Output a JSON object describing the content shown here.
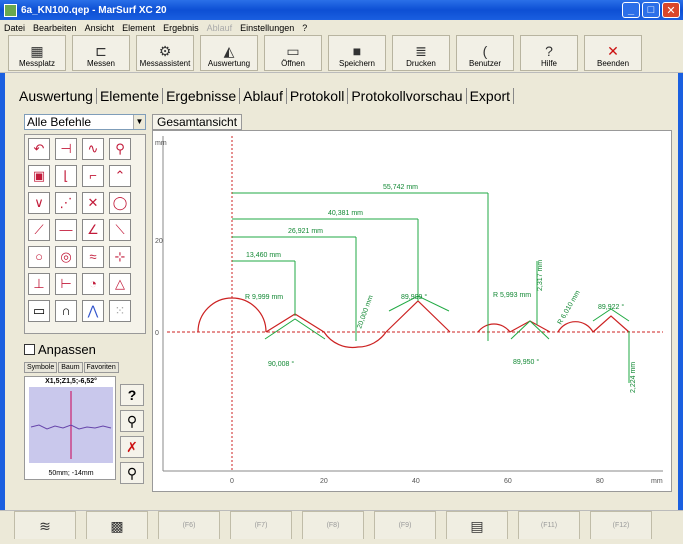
{
  "window": {
    "title": "6a_KN100.qep - MarSurf XC 20"
  },
  "menu": [
    "Datei",
    "Bearbeiten",
    "Ansicht",
    "Element",
    "Ergebnis",
    "Ablauf",
    "Einstellungen",
    "?"
  ],
  "toolbar": [
    {
      "label": "Messplatz",
      "icon": "workstation-icon"
    },
    {
      "label": "Messen",
      "icon": "measure-icon"
    },
    {
      "label": "Messassistent",
      "icon": "assistant-icon"
    },
    {
      "label": "Auswertung",
      "icon": "evaluation-icon"
    },
    {
      "label": "Öffnen",
      "icon": "open-folder-icon"
    },
    {
      "label": "Speichern",
      "icon": "save-icon"
    },
    {
      "label": "Drucken",
      "icon": "print-icon"
    },
    {
      "label": "Benutzer",
      "icon": "user-icon"
    },
    {
      "label": "Hilfe",
      "icon": "help-icon"
    },
    {
      "label": "Beenden",
      "icon": "exit-icon"
    }
  ],
  "tabs": [
    "Auswertung",
    "Elemente",
    "Ergebnisse",
    "Ablauf",
    "Protokoll",
    "Protokollvorschau",
    "Export"
  ],
  "left": {
    "dropdown": "Alle Befehle",
    "checkbox_label": "Anpassen",
    "subtabs": [
      "Symbole",
      "Baum",
      "Favoriten"
    ],
    "preview_title": "X1,5;Z1,5;-6,52°",
    "preview_footer": "50mm; -14mm"
  },
  "view": {
    "tab": "Gesamtansicht",
    "x_unit": "mm",
    "y_unit": "mm"
  },
  "chart_data": {
    "type": "line",
    "xlabel": "mm",
    "ylabel": "mm",
    "x_ticks": [
      "0",
      "20",
      "40",
      "60",
      "80"
    ],
    "y_ticks": [
      "0",
      "20"
    ],
    "annotations": [
      "55,742 mm",
      "40,381 mm",
      "26,921 mm",
      "13,460 mm",
      "R 9,999 mm",
      "20,000 mm",
      "89,999 °",
      "R 5,993 mm",
      "2,317 mm",
      "R 6,010 mm",
      "89,922 °",
      "90,008 °",
      "89,950 °",
      "2,224 mm"
    ]
  },
  "function_keys": [
    "",
    "",
    "(F6)",
    "(F7)",
    "(F8)",
    "(F9)",
    "",
    "(F11)",
    "(F12)"
  ]
}
